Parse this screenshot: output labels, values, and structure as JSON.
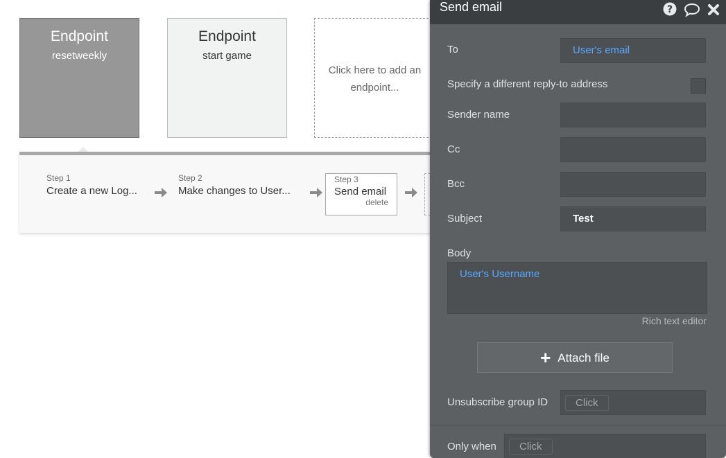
{
  "endpoints": [
    {
      "title": "Endpoint",
      "subtitle": "resetweekly"
    },
    {
      "title": "Endpoint",
      "subtitle": "start game"
    }
  ],
  "add_endpoint": {
    "label": "Click here to add an endpoint..."
  },
  "steps": [
    {
      "number": "Step 1",
      "title": "Create a new Log..."
    },
    {
      "number": "Step 2",
      "title": "Make changes to User..."
    },
    {
      "number": "Step 3",
      "title": "Send email",
      "delete": "delete"
    }
  ],
  "panel": {
    "title": "Send email",
    "icons": [
      "help-icon",
      "comment-icon",
      "close-icon"
    ],
    "to_label": "To",
    "to_value": "User's email",
    "reply_to_label": "Specify a different reply-to address",
    "sender_label": "Sender name",
    "cc_label": "Cc",
    "bcc_label": "Bcc",
    "subject_label": "Subject",
    "subject_value": "Test",
    "body_label": "Body",
    "body_value": "User's Username",
    "rich_text": "Rich text editor",
    "attach_label": "Attach file",
    "unsub_label": "Unsubscribe group ID",
    "unsub_value": "Click",
    "only_when_label": "Only when",
    "only_when_value": "Click"
  },
  "colors": {
    "panel_bg": "#5c6063",
    "header_bg": "#3a3e41",
    "dynamic_blue": "#5aa9ff"
  }
}
